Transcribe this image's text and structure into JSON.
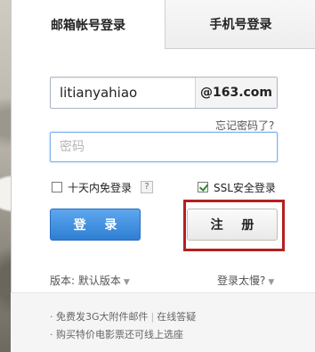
{
  "tabs": {
    "email": "邮箱帐号登录",
    "phone": "手机号登录"
  },
  "account": {
    "value": "litianyahiao",
    "domain": "@163.com"
  },
  "forgot_password": "忘记密码了?",
  "password": {
    "placeholder": "密码"
  },
  "options": {
    "remember_label": "十天内免登录",
    "remember_checked": false,
    "help_glyph": "?",
    "ssl_label": "SSL安全登录",
    "ssl_checked": true
  },
  "buttons": {
    "login": "登 录",
    "register": "注 册"
  },
  "highlight_color": "#b5201f",
  "version": {
    "label": "版本: 默认版本",
    "slow_label": "登录太慢?"
  },
  "footer": {
    "line1_a": "· 免费发3G大附件邮件",
    "line1_sep": "|",
    "line1_b": "在线答疑",
    "line2": "· 购买特价电影票还可线上选座"
  }
}
